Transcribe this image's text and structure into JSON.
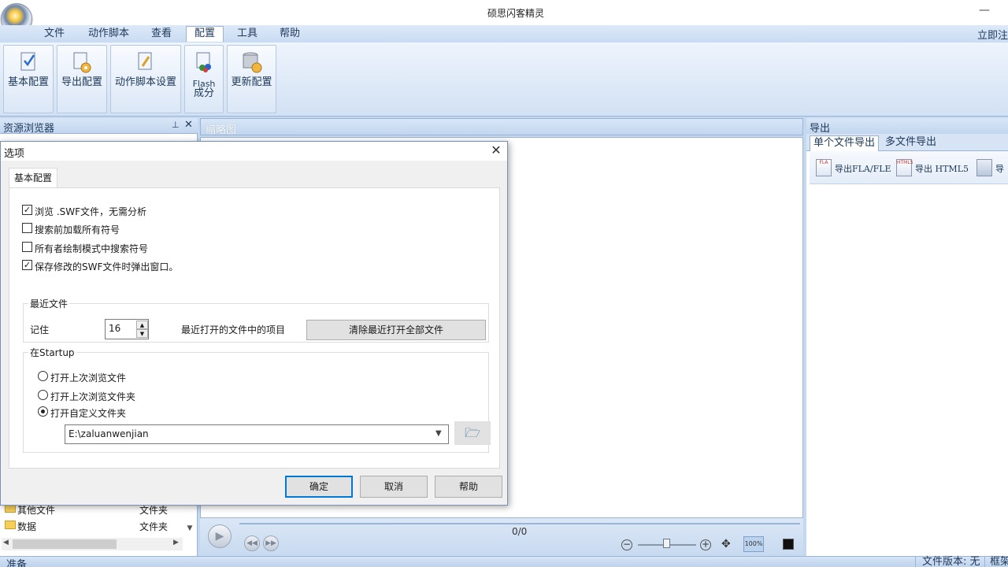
{
  "window": {
    "title": "硕思闪客精灵"
  },
  "menu": [
    "文件",
    "动作脚本",
    "查看",
    "配置",
    "工具",
    "帮助"
  ],
  "menu_active_index": 3,
  "quick_action": "立即注",
  "ribbon": [
    {
      "label": "基本配置",
      "icon": "basic-config-icon"
    },
    {
      "label": "导出配置",
      "icon": "export-config-icon"
    },
    {
      "label": "动作脚本设置",
      "icon": "actionscript-settings-icon"
    },
    {
      "label": "Flash 成分",
      "line1": "Flash",
      "line2": "成分",
      "icon": "flash-component-icon"
    },
    {
      "label": "更新配置",
      "icon": "update-config-icon"
    }
  ],
  "left_pane": {
    "title": "资源浏览器",
    "rows": [
      {
        "name": "其他文件",
        "type": "文件夹"
      },
      {
        "name": "数据",
        "type": "文件夹"
      }
    ]
  },
  "center": {
    "title": "缩略图",
    "frame_count": "0/0",
    "zoom_label": "100%"
  },
  "right_pane": {
    "title": "导出",
    "tabs": [
      "单个文件导出",
      "多文件导出"
    ],
    "active_tab": 0,
    "actions": [
      {
        "label": "导出FLA/FLE",
        "icon": "export-fla-icon",
        "badge": "FLA"
      },
      {
        "label": "导出 HTML5",
        "icon": "export-html5-icon",
        "badge": "HTML5"
      },
      {
        "label": "导",
        "icon": "export-other-icon",
        "badge": ""
      }
    ]
  },
  "status": {
    "ready": "准备",
    "version": "文件版本: 无",
    "frame": "框架"
  },
  "dialog": {
    "title": "选项",
    "tab": "基本配置",
    "checkboxes": [
      {
        "label": "浏览 .SWF文件，无需分析",
        "checked": true
      },
      {
        "label": "搜索前加载所有符号",
        "checked": false
      },
      {
        "label": "所有者绘制模式中搜索符号",
        "checked": false
      },
      {
        "label": "保存修改的SWF文件时弹出窗口。",
        "checked": true
      }
    ],
    "recent": {
      "group_title": "最近文件",
      "remember_label": "记住",
      "value": "16",
      "suffix": "最近打开的文件中的项目",
      "clear_button": "清除最近打开全部文件"
    },
    "startup": {
      "group_title": "在Startup",
      "options": [
        {
          "label": "打开上次浏览文件",
          "selected": false
        },
        {
          "label": "打开上次浏览文件夹",
          "selected": false
        },
        {
          "label": "打开自定义文件夹",
          "selected": true
        }
      ],
      "path": "E:\\zaluanwenjian"
    },
    "buttons": {
      "ok": "确定",
      "cancel": "取消",
      "help": "帮助"
    }
  }
}
